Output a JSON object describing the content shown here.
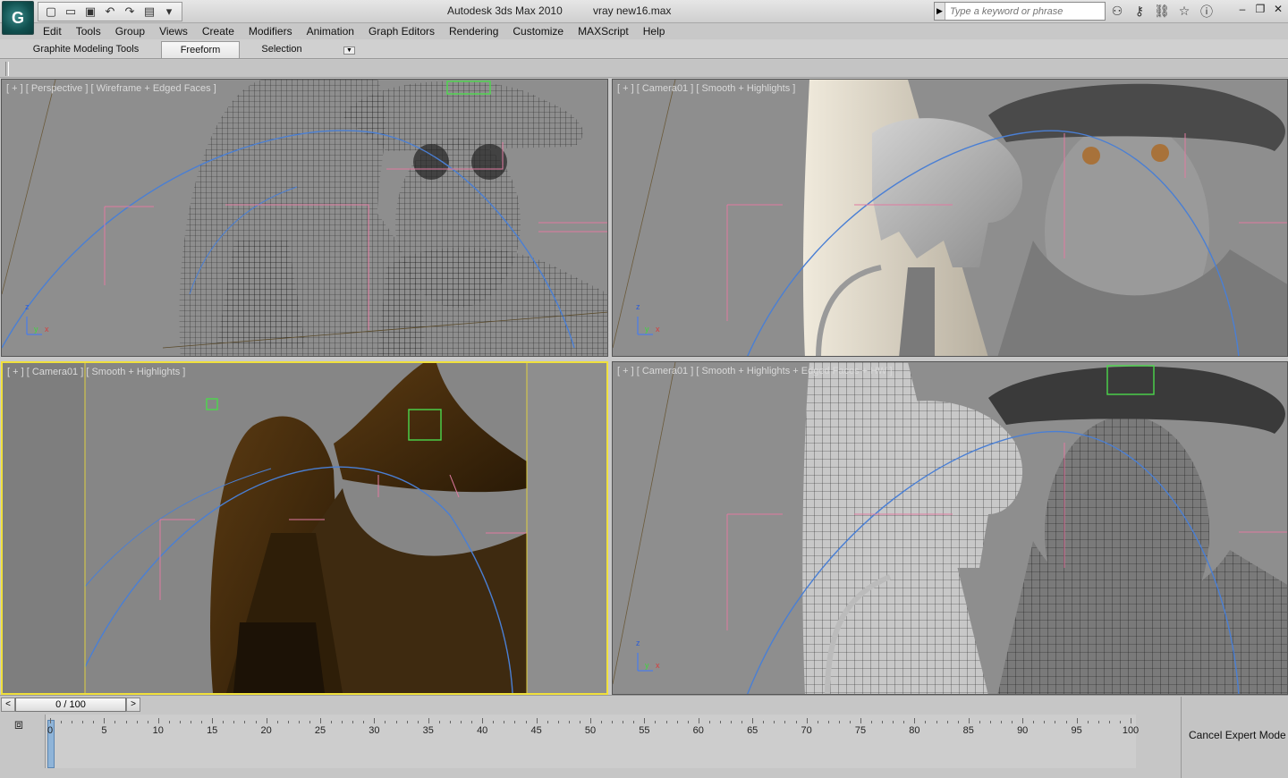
{
  "app": {
    "logo_glyph": "G",
    "title": "Autodesk 3ds Max  2010",
    "file": "vray new16.max"
  },
  "quick_access": [
    "new-icon",
    "open-icon",
    "save-icon",
    "undo-icon",
    "redo-icon",
    "project-icon"
  ],
  "search": {
    "placeholder": "Type a keyword or phrase"
  },
  "info_tools": [
    "binoculars-icon",
    "key-icon",
    "connect-icon",
    "star-icon",
    "help-icon"
  ],
  "menu": [
    "Edit",
    "Tools",
    "Group",
    "Views",
    "Create",
    "Modifiers",
    "Animation",
    "Graph Editors",
    "Rendering",
    "Customize",
    "MAXScript",
    "Help"
  ],
  "ribbon": {
    "tabs": [
      "Graphite Modeling Tools",
      "Freeform",
      "Selection"
    ],
    "active": "Freeform"
  },
  "viewports": [
    {
      "label": "[ + ] [ Perspective ] [ Wireframe + Edged Faces ]",
      "mode": "wireframe"
    },
    {
      "label": "[ + ] [ Camera01 ] [ Smooth + Highlights ]",
      "mode": "smooth"
    },
    {
      "label": "[ + ] [ Camera01 ] [ Smooth + Highlights ]",
      "mode": "dark"
    },
    {
      "label": "[ + ] [ Camera01 ] [ Smooth + Highlights + Edged Faces + HW ]",
      "mode": "edged"
    }
  ],
  "active_viewport": 2,
  "time_slider": {
    "value": "0 / 100",
    "frame": 0,
    "total": 100
  },
  "trackbar": {
    "ticks": [
      "0",
      "5",
      "10",
      "15",
      "20",
      "25",
      "30",
      "35",
      "40",
      "45",
      "50",
      "55",
      "60",
      "65",
      "70",
      "75",
      "80",
      "85",
      "90",
      "95",
      "100"
    ]
  },
  "expert_mode": {
    "label": "Cancel Expert Mode"
  }
}
